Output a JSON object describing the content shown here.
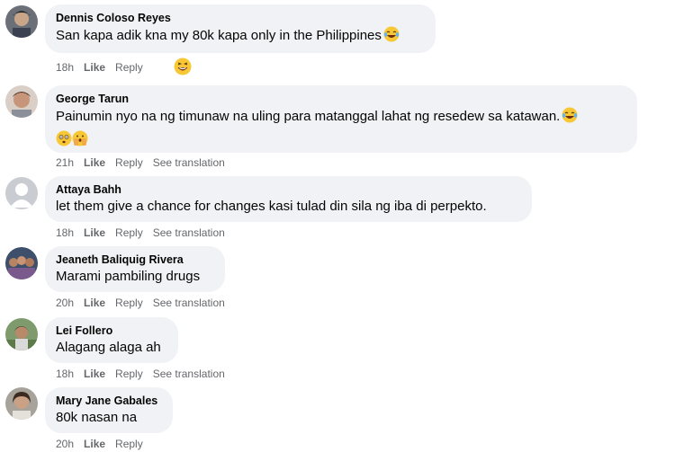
{
  "comments": [
    {
      "author": "Dennis Coloso Reyes",
      "text": "San kapa adik kna my 80k kapa only in the Philippines",
      "time": "18h",
      "like": "Like",
      "reply": "Reply",
      "see_translation": "",
      "emoji": "laughing-crying-emoji",
      "reaction": "laughing-reaction-icon"
    },
    {
      "author": "George Tarun",
      "text": "Painumin nyo na ng timunaw na uling para matanggal lahat ng resedew sa katawan.",
      "time": "21h",
      "like": "Like",
      "reply": "Reply",
      "see_translation": "See translation",
      "emoji": "laughing-crying-emoji"
    },
    {
      "author": "Attaya Bahh",
      "text": "let them give a chance for changes kasi tulad din sila ng iba di perpekto.",
      "time": "18h",
      "like": "Like",
      "reply": "Reply",
      "see_translation": "See translation"
    },
    {
      "author": "Jeaneth Baliquig Rivera",
      "text": "Marami pambiling drugs",
      "time": "20h",
      "like": "Like",
      "reply": "Reply",
      "see_translation": "See translation"
    },
    {
      "author": "Lei Follero",
      "text": "Alagang alaga ah",
      "time": "18h",
      "like": "Like",
      "reply": "Reply",
      "see_translation": "See translation"
    },
    {
      "author": "Mary Jane Gabales",
      "text": "80k nasan na",
      "time": "20h",
      "like": "Like",
      "reply": "Reply",
      "see_translation": ""
    }
  ],
  "colors": {
    "bubble": "#f0f2f5",
    "meta": "#65676b",
    "text": "#050505"
  }
}
